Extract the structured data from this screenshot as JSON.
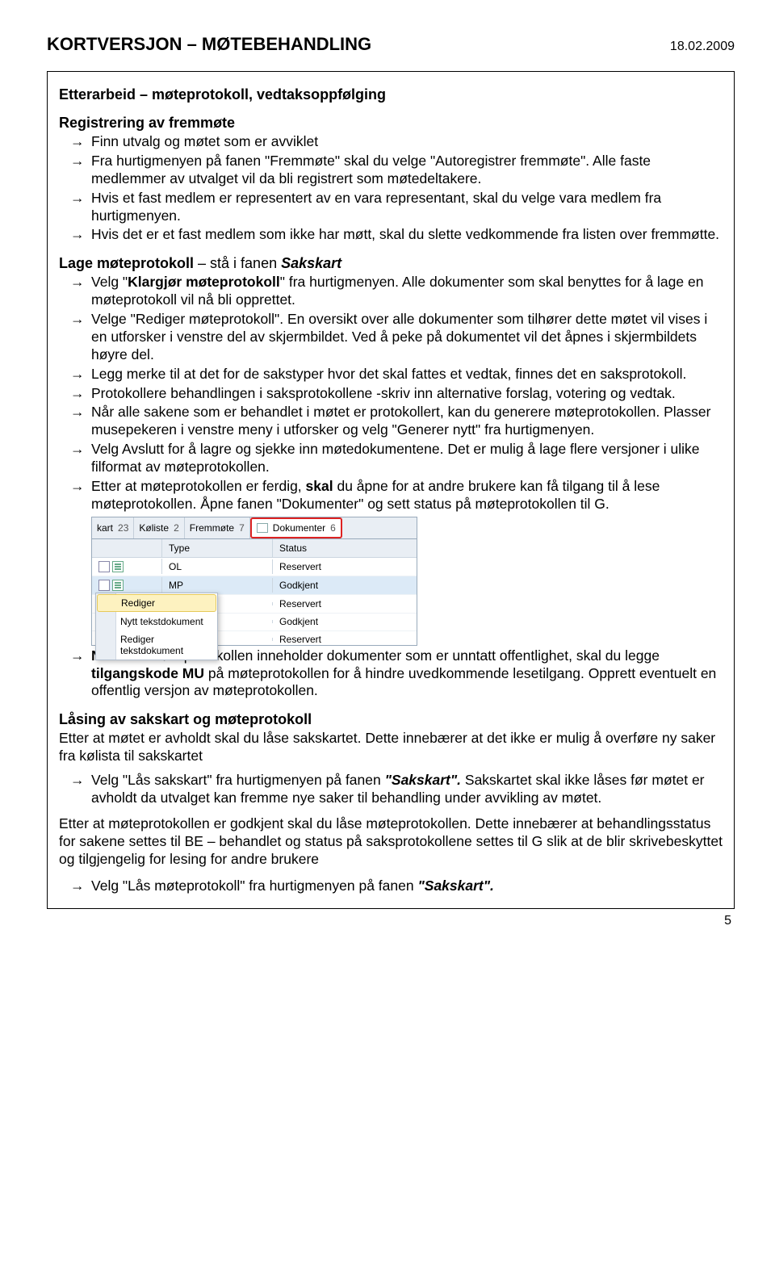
{
  "header": {
    "title": "KORTVERSJON – MØTEBEHANDLING",
    "date": "18.02.2009"
  },
  "section1": {
    "title": "Etterarbeid – møteprotokoll, vedtaksoppfølging",
    "sub1_title": "Registrering av fremmøte",
    "items1": {
      "a": "Finn utvalg og møtet som er avviklet",
      "b": "Fra hurtigmenyen på fanen \"Fremmøte\" skal du velge \"Autoregistrer fremmøte\". Alle faste medlemmer av utvalget vil da bli registrert som møtedeltakere.",
      "c": "Hvis et fast medlem er representert av en vara representant, skal du velge vara medlem fra hurtigmenyen.",
      "d": "Hvis det er et fast medlem som ikke har møtt, skal du slette vedkommende fra listen over fremmøtte."
    },
    "sub2_prefix": "Lage møteprotokoll",
    "sub2_suffix": " – stå i fanen ",
    "sub2_tab": "Sakskart",
    "items2": {
      "a_pre": "Velg \"",
      "a_bold": "Klargjør møteprotokoll",
      "a_post": "\" fra hurtigmenyen. Alle dokumenter som skal benyttes for å lage en møteprotokoll vil nå bli opprettet.",
      "b": "Velge \"Rediger møteprotokoll\". En oversikt over alle dokumenter som tilhører dette møtet vil vises i en utforsker i venstre del av skjermbildet. Ved å peke på dokumentet vil det åpnes i skjermbildets høyre del.",
      "c": "Legg merke til at det for de sakstyper hvor det skal fattes et vedtak, finnes det en saksprotokoll.",
      "d": "Protokollere behandlingen i saksprotokollene -skriv inn alternative forslag, votering og vedtak.",
      "e": "Når alle sakene som er behandlet i møtet er protokollert, kan du generere møteprotokollen. Plasser musepekeren i venstre meny i utforsker og velg \"Generer nytt\" fra hurtigmenyen.",
      "f": "Velg Avslutt for å lagre og sjekke inn møtedokumentene. Det er mulig å lage flere versjoner i ulike filformat av møteprotokollen.",
      "g_pre": "Etter at møteprotokollen er ferdig, ",
      "g_bold": "skal",
      "g_post": " du åpne for at andre brukere kan få tilgang til å lese møteprotokollen. Åpne fanen \"Dokumenter\" og sett status på møteprotokollen til G."
    },
    "nb_label": "NB!",
    "nb_text_pre": " Hvis møteprotokollen inneholder dokumenter som er unntatt offentlighet, skal du legge ",
    "nb_bold": "tilgangskode MU",
    "nb_text_post": " på møteprotokollen for å hindre uvedkommende lesetilgang. Opprett eventuelt en offentlig versjon av møteprotokollen."
  },
  "screenshot": {
    "tabs": {
      "t1_label": "kart",
      "t1_count": "23",
      "t2_label": "Køliste",
      "t2_count": "2",
      "t3_label": "Fremmøte",
      "t3_count": "7",
      "t4_label": "Dokumenter",
      "t4_count": "6"
    },
    "cols": {
      "type": "Type",
      "status": "Status"
    },
    "rows": {
      "r0": {
        "type": "OL",
        "status": "Reservert"
      },
      "r1": {
        "type": "MP",
        "status": "Godkjent"
      },
      "r2": {
        "type": "",
        "status": "Reservert"
      },
      "r3": {
        "type": "",
        "status": "Godkjent"
      },
      "r4": {
        "type": "",
        "status": "Reservert"
      }
    },
    "menu": {
      "m1": "Rediger",
      "m2": "Nytt tekstdokument",
      "m3": "Rediger tekstdokument"
    }
  },
  "section2": {
    "title": "Låsing av sakskart og møteprotokoll",
    "para1": "Etter at møtet er avholdt skal du låse sakskartet. Dette innebærer at det ikke er mulig å overføre ny saker fra kølista til sakskartet",
    "item1_pre": "Velg \"Lås sakskart\" fra hurtigmenyen på fanen ",
    "item1_ital": "\"Sakskart\". ",
    "item1_post": "Sakskartet skal ikke låses før møtet er avholdt da utvalget kan fremme nye saker til behandling under avvikling av møtet.",
    "para2": "Etter at møteprotokollen er godkjent skal du låse møteprotokollen. Dette innebærer at behandlingsstatus for sakene settes til BE – behandlet og status på saksprotokollene settes til G slik at de blir skrivebeskyttet og tilgjengelig for lesing for andre brukere",
    "item2_pre": "Velg \"Lås møteprotokoll\" fra hurtigmenyen på fanen ",
    "item2_ital": "\"Sakskart\"."
  },
  "page_number": "5"
}
